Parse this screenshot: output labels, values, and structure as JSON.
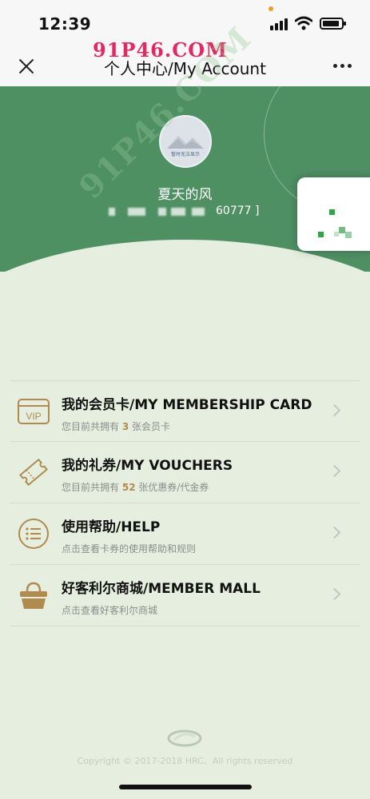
{
  "status_bar": {
    "time": "12:39"
  },
  "nav": {
    "title": "个人中心/My Account",
    "watermark": "91P46.COM"
  },
  "profile": {
    "avatar_caption": "暂时无法显示",
    "nickname": "夏天的风",
    "member_id_suffix": "60777 ]"
  },
  "watermark_diagonal": "91P46.COM",
  "menu": {
    "items": [
      {
        "title": "我的会员卡/MY MEMBERSHIP CARD",
        "sub_prefix": "您目前共拥有",
        "sub_count": "3",
        "sub_suffix": "张会员卡",
        "icon": "vip-card-icon",
        "icon_text": "VIP"
      },
      {
        "title": "我的礼券/MY VOUCHERS",
        "sub_prefix": "您目前共拥有",
        "sub_count": "52",
        "sub_suffix": "张优惠券/代金券",
        "icon": "voucher-ticket-icon"
      },
      {
        "title": "使用帮助/HELP",
        "sub": "点击查看卡券的使用帮助和规则",
        "icon": "list-circle-icon"
      },
      {
        "title": "好客利尔商城/MEMBER MALL",
        "sub": "点击查看好客利尔商城",
        "icon": "shopping-basket-icon"
      }
    ]
  },
  "footer": {
    "copyright": "Copyright © 2017-2018 HRC、All rights reserved"
  },
  "colors": {
    "brand_green": "#4f9063",
    "background": "#e6efdf",
    "accent_gold": "#b08a4f"
  }
}
